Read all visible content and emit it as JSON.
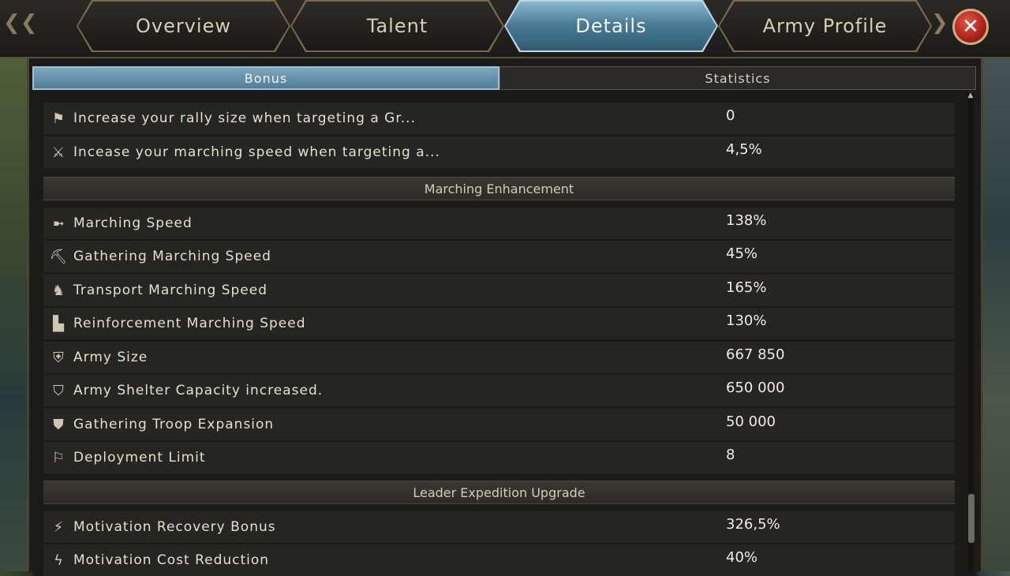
{
  "tabs": [
    {
      "label": "Overview",
      "active": false
    },
    {
      "label": "Talent",
      "active": false
    },
    {
      "label": "Details",
      "active": true
    },
    {
      "label": "Army Profile",
      "active": false
    }
  ],
  "close_button": {
    "symbol": "✕"
  },
  "subtabs": [
    {
      "label": "Bonus",
      "active": true
    },
    {
      "label": "Statistics",
      "active": false
    }
  ],
  "rows": [
    {
      "icon": "rally-icon",
      "label": "Increase your rally size when targeting a Gr...",
      "value": "0"
    },
    {
      "icon": "march-target-icon",
      "label": "Incease your marching speed when targeting a...",
      "value": "4,5%"
    }
  ],
  "section_marching": {
    "title": "Marching Enhancement"
  },
  "marching_rows": [
    {
      "icon": "marching-speed-icon",
      "label": "Marching Speed",
      "value": "138%"
    },
    {
      "icon": "pickaxe-icon",
      "label": "Gathering Marching Speed",
      "value": "45%"
    },
    {
      "icon": "horse-icon",
      "label": "Transport Marching Speed",
      "value": "165%"
    },
    {
      "icon": "boot-icon",
      "label": "Reinforcement Marching Speed",
      "value": "130%"
    },
    {
      "icon": "army-shield-icon",
      "label": "Army Size",
      "value": "667 850"
    },
    {
      "icon": "shelter-icon",
      "label": "Army Shelter Capacity increased.",
      "value": "650 000"
    },
    {
      "icon": "troop-shield-icon",
      "label": "Gathering Troop Expansion",
      "value": "50 000"
    },
    {
      "icon": "flag-icon",
      "label": "Deployment Limit",
      "value": "8"
    }
  ],
  "section_leader": {
    "title": "Leader Expedition Upgrade"
  },
  "leader_rows": [
    {
      "icon": "motivation-recovery-icon",
      "label": "Motivation Recovery Bonus",
      "value": "326,5%"
    },
    {
      "icon": "motivation-cost-icon",
      "label": "Motivation Cost Reduction",
      "value": "40%"
    }
  ],
  "colors": {
    "accent": "#5b8aa6",
    "text": "#e8dfc9",
    "close": "#b3231c"
  }
}
